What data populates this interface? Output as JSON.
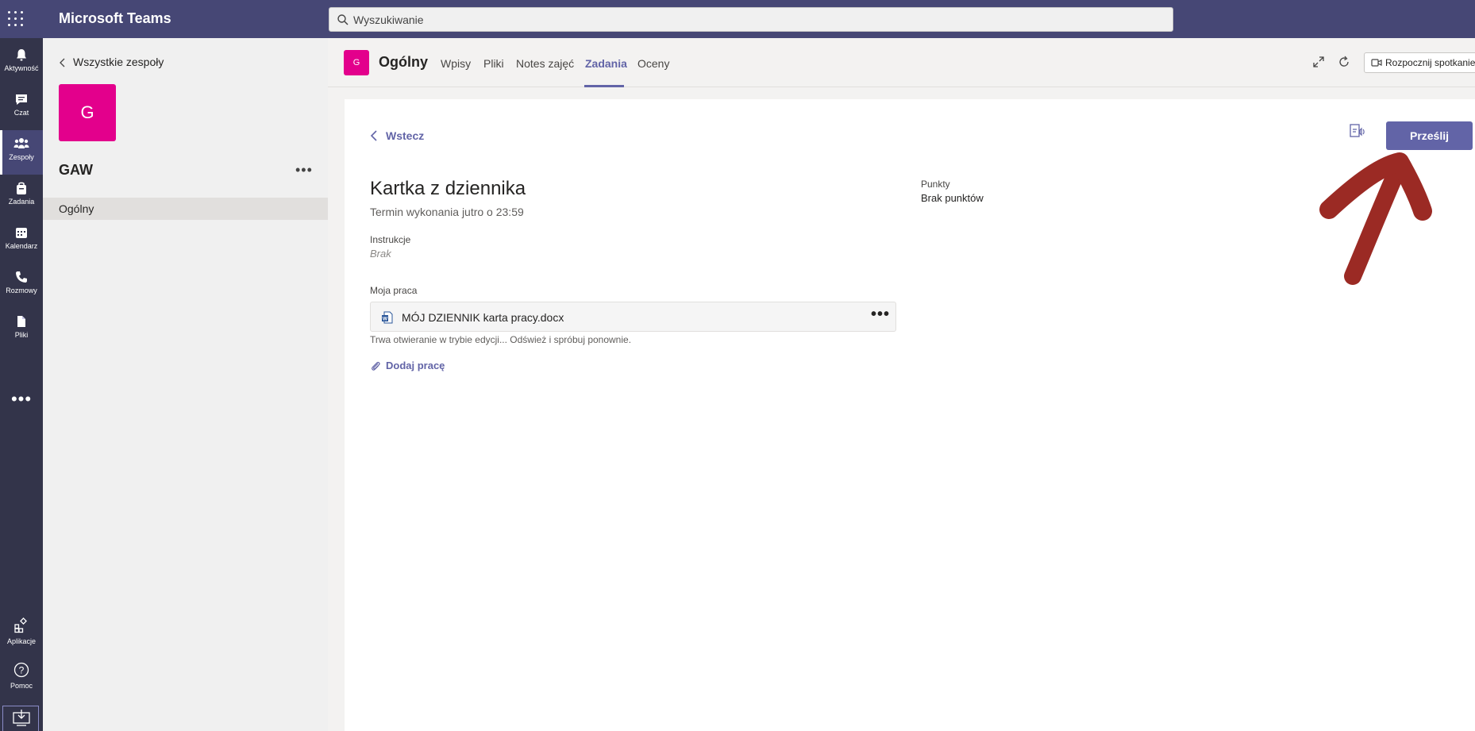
{
  "app": {
    "title": "Microsoft Teams"
  },
  "search": {
    "placeholder": "Wyszukiwanie"
  },
  "rail": {
    "items": [
      {
        "label": "Aktywność",
        "icon": "bell-icon"
      },
      {
        "label": "Czat",
        "icon": "chat-icon"
      },
      {
        "label": "Zespoły",
        "icon": "teams-icon"
      },
      {
        "label": "Zadania",
        "icon": "assignments-icon"
      },
      {
        "label": "Kalendarz",
        "icon": "calendar-icon"
      },
      {
        "label": "Rozmowy",
        "icon": "phone-icon"
      },
      {
        "label": "Pliki",
        "icon": "files-icon"
      }
    ],
    "more": "•••",
    "apps_label": "Aplikacje",
    "help_label": "Pomoc"
  },
  "team_pane": {
    "back_label": "Wszystkie zespoły",
    "avatar_letter": "G",
    "team_name": "GAW",
    "more": "•••",
    "channels": [
      "Ogólny"
    ]
  },
  "channel_header": {
    "avatar_letter": "G",
    "title": "Ogólny",
    "tabs": [
      "Wpisy",
      "Pliki",
      "Notes zajęć",
      "Zadania",
      "Oceny"
    ],
    "active_tab": "Zadania",
    "meet_label": "Rozpocznij spotkanie"
  },
  "assignment": {
    "back_label": "Wstecz",
    "title": "Kartka z dziennika",
    "due": "Termin wykonania jutro o 23:59",
    "instructions_label": "Instrukcje",
    "instructions_value": "Brak",
    "points_label": "Punkty",
    "points_value": "Brak punktów",
    "work_label": "Moja praca",
    "file_name": "MÓJ DZIENNIK karta pracy.docx",
    "file_more": "•••",
    "file_message": "Trwa otwieranie w trybie edycji... Odśwież i spróbuj ponownie.",
    "add_work_label": "Dodaj pracę",
    "submit_label": "Prześlij"
  },
  "colors": {
    "topbar": "#464775",
    "rail": "#33344a",
    "accent": "#6264a7",
    "team_avatar": "#e3008c",
    "annotation_arrow": "#9b2a24"
  }
}
